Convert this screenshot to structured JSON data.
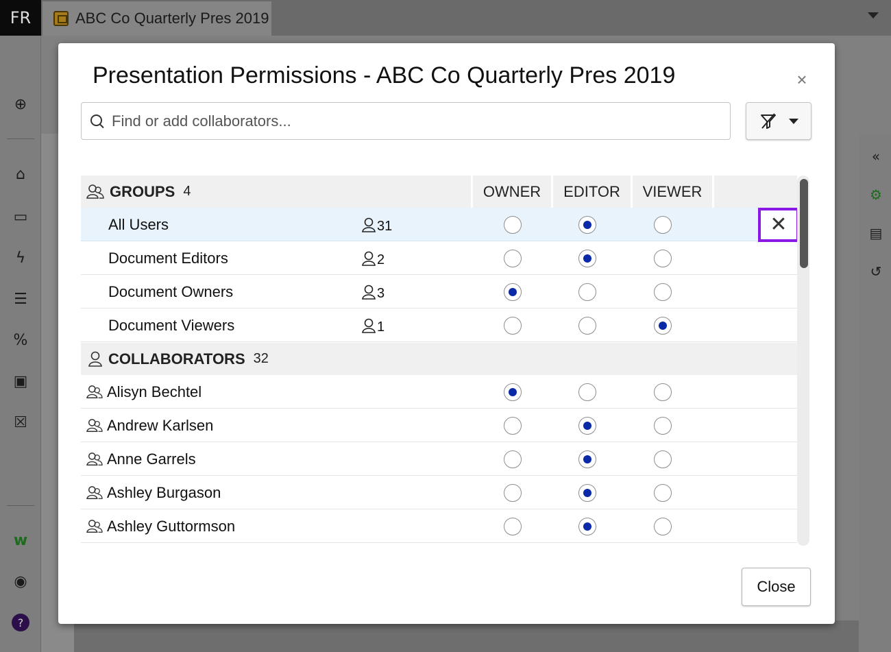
{
  "app": {
    "user_initials": "FR",
    "document_tab": "ABC Co Quarterly Pres 2019"
  },
  "dialog": {
    "title": "Presentation Permissions - ABC Co Quarterly Pres 2019",
    "close_symbol": "×",
    "search_placeholder": "Find or add collaborators...",
    "columns": {
      "owner": "OWNER",
      "editor": "EDITOR",
      "viewer": "VIEWER"
    },
    "groups_section": {
      "title": "GROUPS",
      "count": "4"
    },
    "groups": [
      {
        "name": "All Users",
        "members": "31",
        "role": "editor",
        "selected": true
      },
      {
        "name": "Document Editors",
        "members": "2",
        "role": "editor"
      },
      {
        "name": "Document Owners",
        "members": "3",
        "role": "owner"
      },
      {
        "name": "Document Viewers",
        "members": "1",
        "role": "viewer"
      }
    ],
    "remove_symbol": "✕",
    "collaborators_section": {
      "title": "COLLABORATORS",
      "count": "32"
    },
    "collaborators": [
      {
        "name": "Alisyn Bechtel",
        "role": "owner"
      },
      {
        "name": "Andrew Karlsen",
        "role": "editor"
      },
      {
        "name": "Anne Garrels",
        "role": "editor"
      },
      {
        "name": "Ashley Burgason",
        "role": "editor"
      },
      {
        "name": "Ashley Guttormson",
        "role": "editor"
      }
    ],
    "close_button": "Close"
  },
  "colors": {
    "radio_checked": "#0a2aa8",
    "selected_row": "#e8f3fb",
    "highlight_outline": "#8b19e6"
  }
}
